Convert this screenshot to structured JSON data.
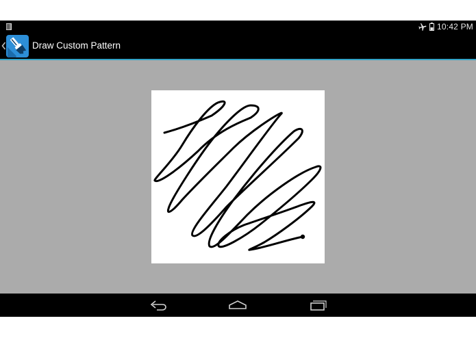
{
  "status_bar": {
    "time": "10:42 PM",
    "icons": [
      "notification-icon",
      "airplane-mode-icon",
      "battery-icon"
    ]
  },
  "action_bar": {
    "title": "Draw Custom Pattern",
    "icons": [
      "up-caret-icon",
      "app-brush-icon"
    ],
    "accent_color": "#33a4c8"
  },
  "content": {
    "background_color": "#ababab",
    "canvas_background": "#ffffff",
    "stroke_color": "#000000"
  },
  "nav_bar": {
    "buttons": [
      "back-icon",
      "home-icon",
      "recent-apps-icon"
    ]
  }
}
